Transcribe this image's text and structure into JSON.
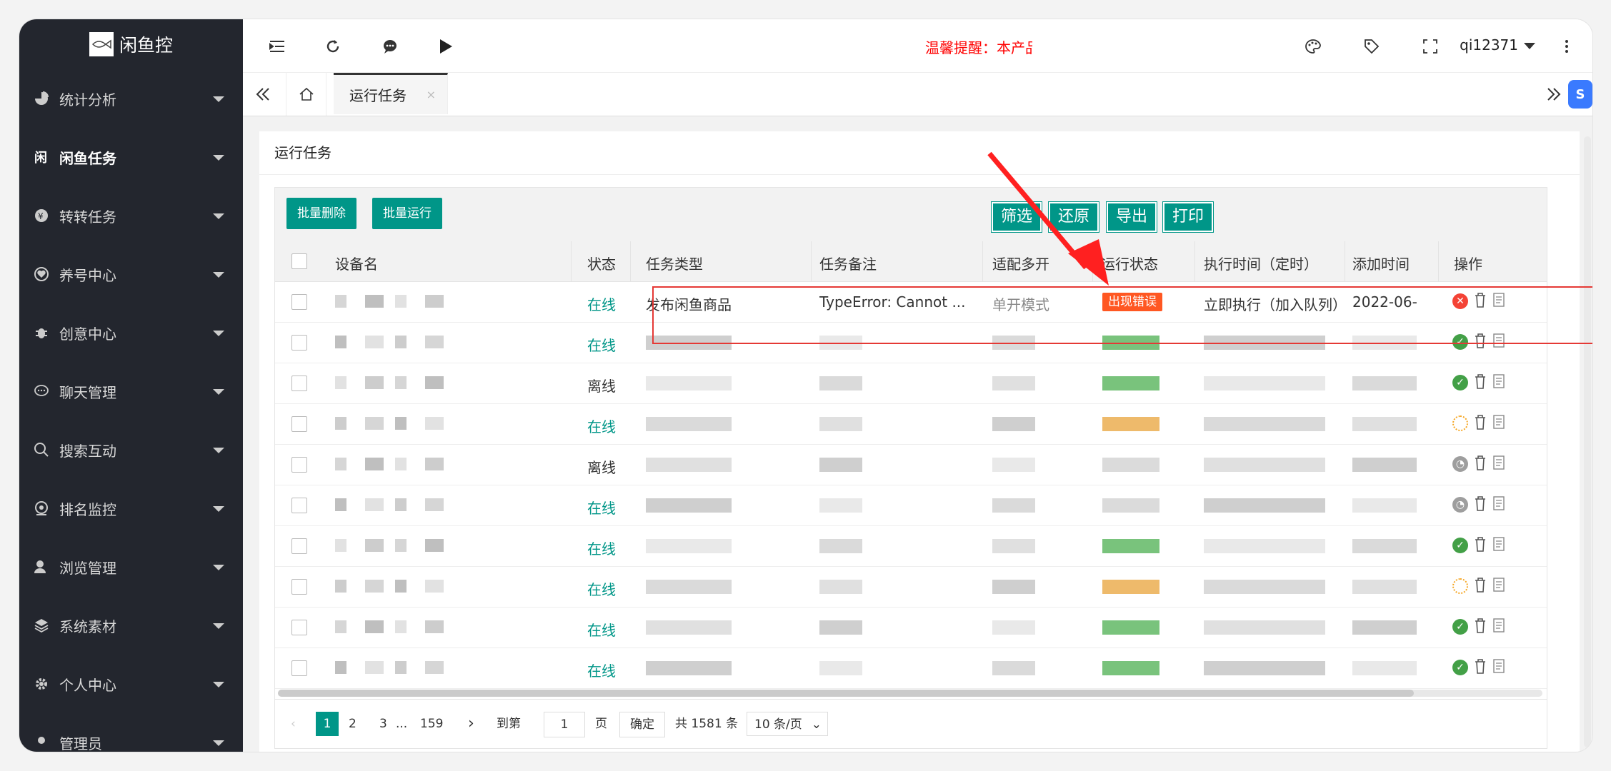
{
  "app": {
    "logo_text": "闲鱼控"
  },
  "sidebar": {
    "items": [
      {
        "label": "统计分析",
        "icon": "pie-chart-icon"
      },
      {
        "label": "闲鱼任务",
        "icon": "xianyu-icon",
        "active": true
      },
      {
        "label": "转转任务",
        "icon": "coin-icon"
      },
      {
        "label": "养号中心",
        "icon": "heart-icon"
      },
      {
        "label": "创意中心",
        "icon": "bug-icon"
      },
      {
        "label": "聊天管理",
        "icon": "chat-icon"
      },
      {
        "label": "搜索互动",
        "icon": "search-icon"
      },
      {
        "label": "排名监控",
        "icon": "monitor-icon"
      },
      {
        "label": "浏览管理",
        "icon": "user-icon"
      },
      {
        "label": "系统素材",
        "icon": "layers-icon"
      },
      {
        "label": "个人中心",
        "icon": "gear-icon"
      },
      {
        "label": "管理员",
        "icon": "admin-icon"
      }
    ]
  },
  "topbar": {
    "notice": "温馨提醒：本产品",
    "username": "qi12371"
  },
  "tabs": {
    "current": "运行任务",
    "close": "×"
  },
  "page": {
    "title": "运行任务"
  },
  "toolbar": {
    "batch_delete": "批量删除",
    "batch_run": "批量运行",
    "filter": "筛选",
    "restore": "还原",
    "export": "导出",
    "print": "打印"
  },
  "table": {
    "columns": [
      "设备名",
      "状态",
      "任务类型",
      "任务备注",
      "适配多开",
      "运行状态",
      "执行时间（定时）",
      "添加时间",
      "操作"
    ],
    "rows": [
      {
        "status": "在线",
        "task_type": "发布闲鱼商品",
        "note": "TypeError: Cannot ...",
        "multi": "单开模式",
        "run_status": "出现错误",
        "exec_time": "立即执行（加入队列）",
        "add_time": "2022-06-",
        "op": "error"
      },
      {
        "status": "在线",
        "op": "ok"
      },
      {
        "status": "离线",
        "op": "ok"
      },
      {
        "status": "在线",
        "op": "loading"
      },
      {
        "status": "离线",
        "op": "clock"
      },
      {
        "status": "在线",
        "op": "clock"
      },
      {
        "status": "在线",
        "op": "ok"
      },
      {
        "status": "在线",
        "op": "loading"
      },
      {
        "status": "在线",
        "op": "ok"
      },
      {
        "status": "在线",
        "op": "ok"
      }
    ]
  },
  "pagination": {
    "pages": [
      "1",
      "2",
      "3",
      "...",
      "159"
    ],
    "goto_label": "到第",
    "goto_value": "1",
    "page_unit": "页",
    "confirm": "确定",
    "total": "共 1581 条",
    "per_page": "10 条/页"
  },
  "colors": {
    "accent": "#009688",
    "sidebar": "#23262e",
    "error": "#ff5722",
    "highlight": "#e53935"
  }
}
